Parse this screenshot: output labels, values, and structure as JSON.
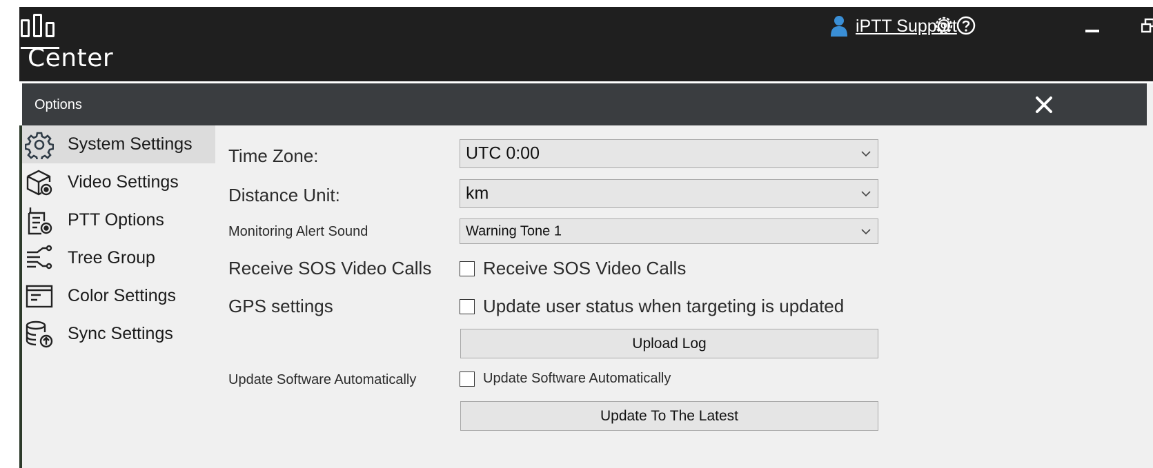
{
  "app": {
    "title": "Center",
    "user": "iPTT Support",
    "icons": {
      "logo": "logo-bars-icon",
      "user": "user-icon",
      "settings": "gear-icon",
      "help": "help-icon",
      "minimize": "minimize-icon",
      "restore": "restore-icon"
    },
    "colors": {
      "bar": "#1f1f1f",
      "user_icon": "#3a8fd6"
    }
  },
  "dialog": {
    "title": "Options",
    "close_icon": "close-icon",
    "header_color": "#3a3d40"
  },
  "nav": {
    "items": [
      {
        "label": "System Settings",
        "icon": "gear-icon",
        "active": true
      },
      {
        "label": "Video Settings",
        "icon": "video-settings-icon",
        "active": false
      },
      {
        "label": "PTT Options",
        "icon": "ptt-radio-icon",
        "active": false
      },
      {
        "label": "Tree Group",
        "icon": "tree-group-icon",
        "active": false
      },
      {
        "label": "Color Settings",
        "icon": "color-settings-icon",
        "active": false
      },
      {
        "label": "Sync Settings",
        "icon": "sync-database-icon",
        "active": false
      }
    ]
  },
  "form": {
    "time_zone": {
      "label": "Time Zone:",
      "value": "UTC 0:00"
    },
    "distance_unit": {
      "label": "Distance Unit:",
      "value": "km"
    },
    "alert_sound": {
      "label": "Monitoring Alert Sound",
      "value": "Warning Tone 1"
    },
    "sos": {
      "label": "Receive SOS Video Calls",
      "checkbox_label": "Receive SOS Video Calls",
      "checked": false
    },
    "gps": {
      "label": "GPS settings",
      "checkbox_label": "Update user status when targeting is updated",
      "checked": false
    },
    "upload_log": {
      "label": "Upload Log"
    },
    "auto_update": {
      "label": "Update Software Automatically",
      "checkbox_label": "Update Software Automatically",
      "checked": false
    },
    "update_latest": {
      "label": "Update To The Latest"
    }
  }
}
